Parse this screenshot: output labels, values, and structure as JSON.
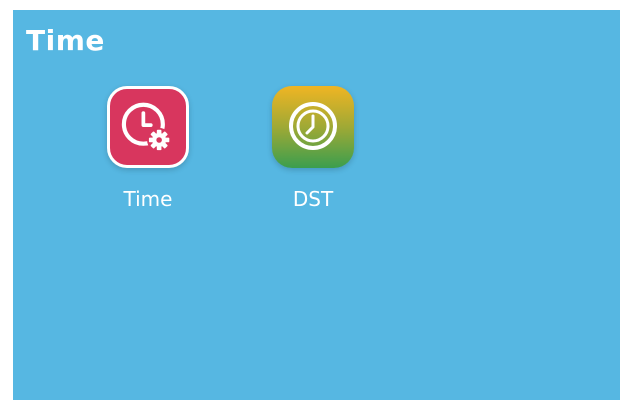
{
  "header": {
    "title": "Time"
  },
  "apps": [
    {
      "label": "Time",
      "icon": "clock-settings-icon",
      "color": "#d8365e"
    },
    {
      "label": "DST",
      "icon": "clock-icon",
      "color": "#3b9e4e"
    }
  ],
  "colors": {
    "background": "#56b7e2",
    "text": "#ffffff"
  }
}
